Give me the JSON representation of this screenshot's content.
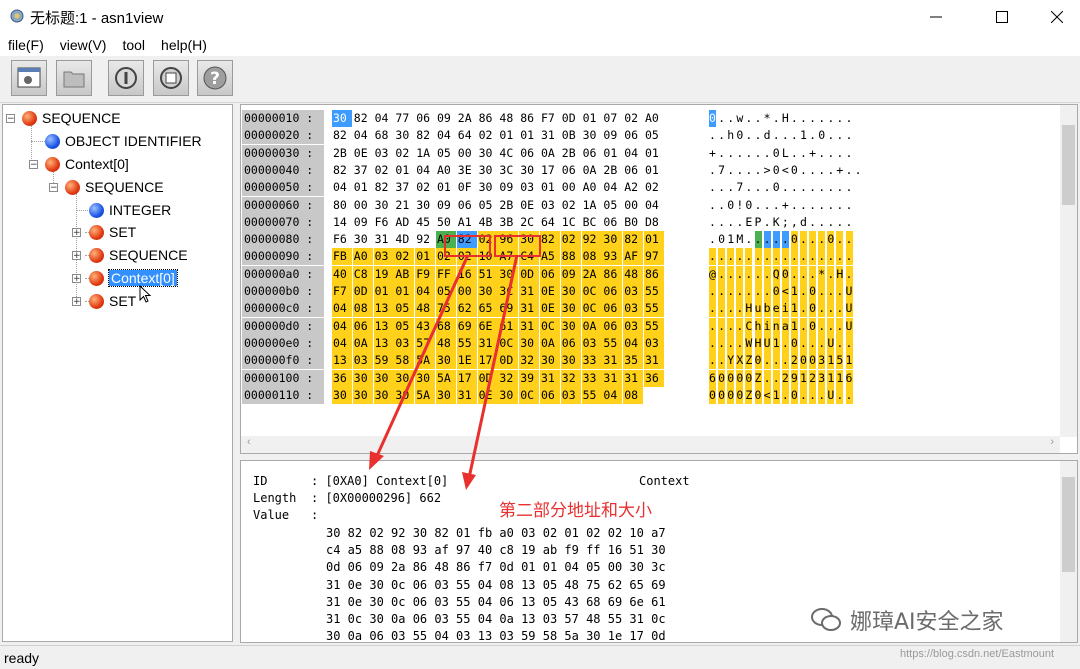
{
  "window": {
    "title": "无标题:1 - asn1view",
    "icon": "app-icon",
    "controls": [
      "minimize-icon",
      "maximize-icon",
      "close-icon"
    ]
  },
  "menu": [
    "file(F)",
    "view(V)",
    "tool",
    "help(H)"
  ],
  "toolbar": {
    "buttons": [
      "open-file-icon",
      "folder-icon",
      "info-icon",
      "save-icon",
      "help-icon"
    ]
  },
  "tree": [
    {
      "label": "SEQUENCE",
      "color": "#e23a12"
    },
    {
      "label": "OBJECT IDENTIFIER",
      "color": "#1c55e6"
    },
    {
      "label": "Context[0]",
      "color": "#e23a12"
    },
    {
      "label": "SEQUENCE",
      "color": "#e23a12"
    },
    {
      "label": "INTEGER",
      "color": "#1c55e6"
    },
    {
      "label": "SET",
      "color": "#e23a12"
    },
    {
      "label": "SEQUENCE",
      "color": "#e23a12"
    },
    {
      "label": "Context[0]",
      "color": "#e23a12",
      "selected": true
    },
    {
      "label": "SET",
      "color": "#e23a12"
    }
  ],
  "hex": {
    "rows": [
      {
        "addr": "00000010 :",
        "bytes": [
          "30",
          "82",
          "04",
          "77",
          "06",
          "09",
          "2A",
          "86",
          "48",
          "86",
          "F7",
          "0D",
          "01",
          "07",
          "02",
          "A0"
        ],
        "ascii": "0..w..*.H......."
      },
      {
        "addr": "00000020 :",
        "bytes": [
          "82",
          "04",
          "68",
          "30",
          "82",
          "04",
          "64",
          "02",
          "01",
          "01",
          "31",
          "0B",
          "30",
          "09",
          "06",
          "05"
        ],
        "ascii": "..h0..d...1.0..."
      },
      {
        "addr": "00000030 :",
        "bytes": [
          "2B",
          "0E",
          "03",
          "02",
          "1A",
          "05",
          "00",
          "30",
          "4C",
          "06",
          "0A",
          "2B",
          "06",
          "01",
          "04",
          "01"
        ],
        "ascii": "+......0L..+...."
      },
      {
        "addr": "00000040 :",
        "bytes": [
          "82",
          "37",
          "02",
          "01",
          "04",
          "A0",
          "3E",
          "30",
          "3C",
          "30",
          "17",
          "06",
          "0A",
          "2B",
          "06",
          "01"
        ],
        "ascii": ".7....>0<0....+.."
      },
      {
        "addr": "00000050 :",
        "bytes": [
          "04",
          "01",
          "82",
          "37",
          "02",
          "01",
          "0F",
          "30",
          "09",
          "03",
          "01",
          "00",
          "A0",
          "04",
          "A2",
          "02"
        ],
        "ascii": "...7...0........"
      },
      {
        "addr": "00000060 :",
        "bytes": [
          "80",
          "00",
          "30",
          "21",
          "30",
          "09",
          "06",
          "05",
          "2B",
          "0E",
          "03",
          "02",
          "1A",
          "05",
          "00",
          "04"
        ],
        "ascii": "..0!0...+......."
      },
      {
        "addr": "00000070 :",
        "bytes": [
          "14",
          "09",
          "F6",
          "AD",
          "45",
          "50",
          "A1",
          "4B",
          "3B",
          "2C",
          "64",
          "1C",
          "BC",
          "06",
          "B0",
          "D8"
        ],
        "ascii": "....EP.K;,d....."
      },
      {
        "addr": "00000080 :",
        "bytes": [
          "F6",
          "30",
          "31",
          "4D",
          "92",
          "A0",
          "82",
          "02",
          "96",
          "30",
          "82",
          "02",
          "92",
          "30",
          "82",
          "01"
        ],
        "ascii": ".01M.....0...0.."
      },
      {
        "addr": "00000090 :",
        "bytes": [
          "FB",
          "A0",
          "03",
          "02",
          "01",
          "02",
          "02",
          "10",
          "A7",
          "C4",
          "A5",
          "88",
          "08",
          "93",
          "AF",
          "97"
        ],
        "ascii": "................"
      },
      {
        "addr": "000000a0 :",
        "bytes": [
          "40",
          "C8",
          "19",
          "AB",
          "F9",
          "FF",
          "16",
          "51",
          "30",
          "0D",
          "06",
          "09",
          "2A",
          "86",
          "48",
          "86"
        ],
        "ascii": "@......Q0...*.H."
      },
      {
        "addr": "000000b0 :",
        "bytes": [
          "F7",
          "0D",
          "01",
          "01",
          "04",
          "05",
          "00",
          "30",
          "3C",
          "31",
          "0E",
          "30",
          "0C",
          "06",
          "03",
          "55"
        ],
        "ascii": ".......0<1.0...U"
      },
      {
        "addr": "000000c0 :",
        "bytes": [
          "04",
          "08",
          "13",
          "05",
          "48",
          "75",
          "62",
          "65",
          "69",
          "31",
          "0E",
          "30",
          "0C",
          "06",
          "03",
          "55"
        ],
        "ascii": "....Hubei1.0...U"
      },
      {
        "addr": "000000d0 :",
        "bytes": [
          "04",
          "06",
          "13",
          "05",
          "43",
          "68",
          "69",
          "6E",
          "61",
          "31",
          "0C",
          "30",
          "0A",
          "06",
          "03",
          "55"
        ],
        "ascii": "....China1.0...U"
      },
      {
        "addr": "000000e0 :",
        "bytes": [
          "04",
          "0A",
          "13",
          "03",
          "57",
          "48",
          "55",
          "31",
          "0C",
          "30",
          "0A",
          "06",
          "03",
          "55",
          "04",
          "03"
        ],
        "ascii": "....WHU1.0...U.."
      },
      {
        "addr": "000000f0 :",
        "bytes": [
          "13",
          "03",
          "59",
          "58",
          "5A",
          "30",
          "1E",
          "17",
          "0D",
          "32",
          "30",
          "30",
          "33",
          "31",
          "35",
          "31"
        ],
        "ascii": "..YXZ0...2003151"
      },
      {
        "addr": "00000100 :",
        "bytes": [
          "36",
          "30",
          "30",
          "30",
          "30",
          "5A",
          "17",
          "0D",
          "32",
          "39",
          "31",
          "32",
          "33",
          "31",
          "31",
          "36"
        ],
        "ascii": "60000Z..29123116"
      },
      {
        "addr": "00000110 :",
        "bytes": [
          "30",
          "30",
          "30",
          "30",
          "5A",
          "30",
          "31",
          "0E",
          "30",
          "0C",
          "06",
          "03",
          "55",
          "04",
          "08"
        ],
        "ascii": "0000Z0<1.0...U.."
      }
    ]
  },
  "detail": {
    "id_label": "ID",
    "id_value": ": [0XA0] Context[0]",
    "id_type": "Context",
    "length_label": "Length",
    "length_value": ": [0X00000296] 662",
    "value_label": "Value",
    "value_sep": ":",
    "value_lines": [
      "30 82 02 92 30 82 01 fb a0 03 02 01 02 02 10 a7",
      "c4 a5 88 08 93 af 97 40 c8 19 ab f9 ff 16 51 30",
      "0d 06 09 2a 86 48 86 f7 0d 01 01 04 05 00 30 3c",
      "31 0e 30 0c 06 03 55 04 08 13 05 48 75 62 65 69",
      "31 0e 30 0c 06 03 55 04 06 13 05 43 68 69 6e 61",
      "31 0c 30 0a 06 03 55 04 0a 13 03 57 48 55 31 0c",
      "30 0a 06 03 55 04 03 13 03 59 58 5a 30 1e 17 0d"
    ],
    "annotation": "第二部分地址和大小"
  },
  "status": "ready",
  "watermark": "娜璋AI安全之家",
  "blog_url": "https://blog.csdn.net/Eastmount"
}
